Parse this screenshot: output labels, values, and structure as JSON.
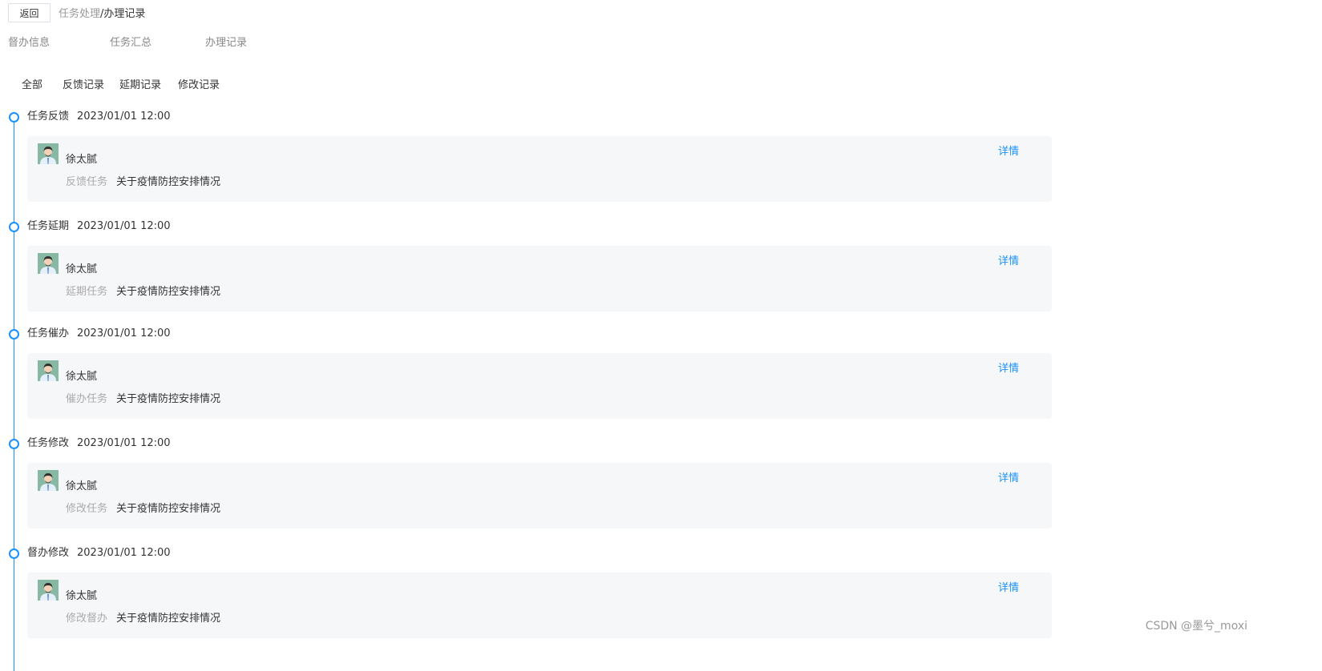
{
  "header": {
    "back_label": "返回",
    "breadcrumb": {
      "parent": "任务处理",
      "separator": "/",
      "current": "办理记录"
    }
  },
  "main_tabs": [
    {
      "label": "督办信息"
    },
    {
      "label": "任务汇总"
    },
    {
      "label": "办理记录"
    }
  ],
  "filter_tabs": [
    {
      "label": "全部"
    },
    {
      "label": "反馈记录"
    },
    {
      "label": "延期记录"
    },
    {
      "label": "修改记录"
    }
  ],
  "records": [
    {
      "type": "任务反馈",
      "time": "2023/01/01  12:00",
      "user": "徐太腻",
      "field_label": "反馈任务",
      "field_value": "关于疫情防控安排情况",
      "action": "详情"
    },
    {
      "type": "任务延期",
      "time": "2023/01/01  12:00",
      "user": "徐太腻",
      "field_label": "延期任务",
      "field_value": "关于疫情防控安排情况",
      "action": "详情"
    },
    {
      "type": "任务催办",
      "time": "2023/01/01  12:00",
      "user": "徐太腻",
      "field_label": "催办任务",
      "field_value": "关于疫情防控安排情况",
      "action": "详情"
    },
    {
      "type": "任务修改",
      "time": "2023/01/01  12:00",
      "user": "徐太腻",
      "field_label": "修改任务",
      "field_value": "关于疫情防控安排情况",
      "action": "详情"
    },
    {
      "type": "督办修改",
      "time": "2023/01/01  12:00",
      "user": "徐太腻",
      "field_label": "修改督办",
      "field_value": "关于疫情防控安排情况",
      "action": "详情"
    }
  ],
  "watermark": "CSDN @墨兮_moxi",
  "colors": {
    "accent": "#1890ff",
    "card_bg": "#f6f7f9",
    "muted_text": "#aaaaaa"
  },
  "icons": {
    "avatar": "user-avatar-icon",
    "timeline_node": "circle-node-icon"
  }
}
